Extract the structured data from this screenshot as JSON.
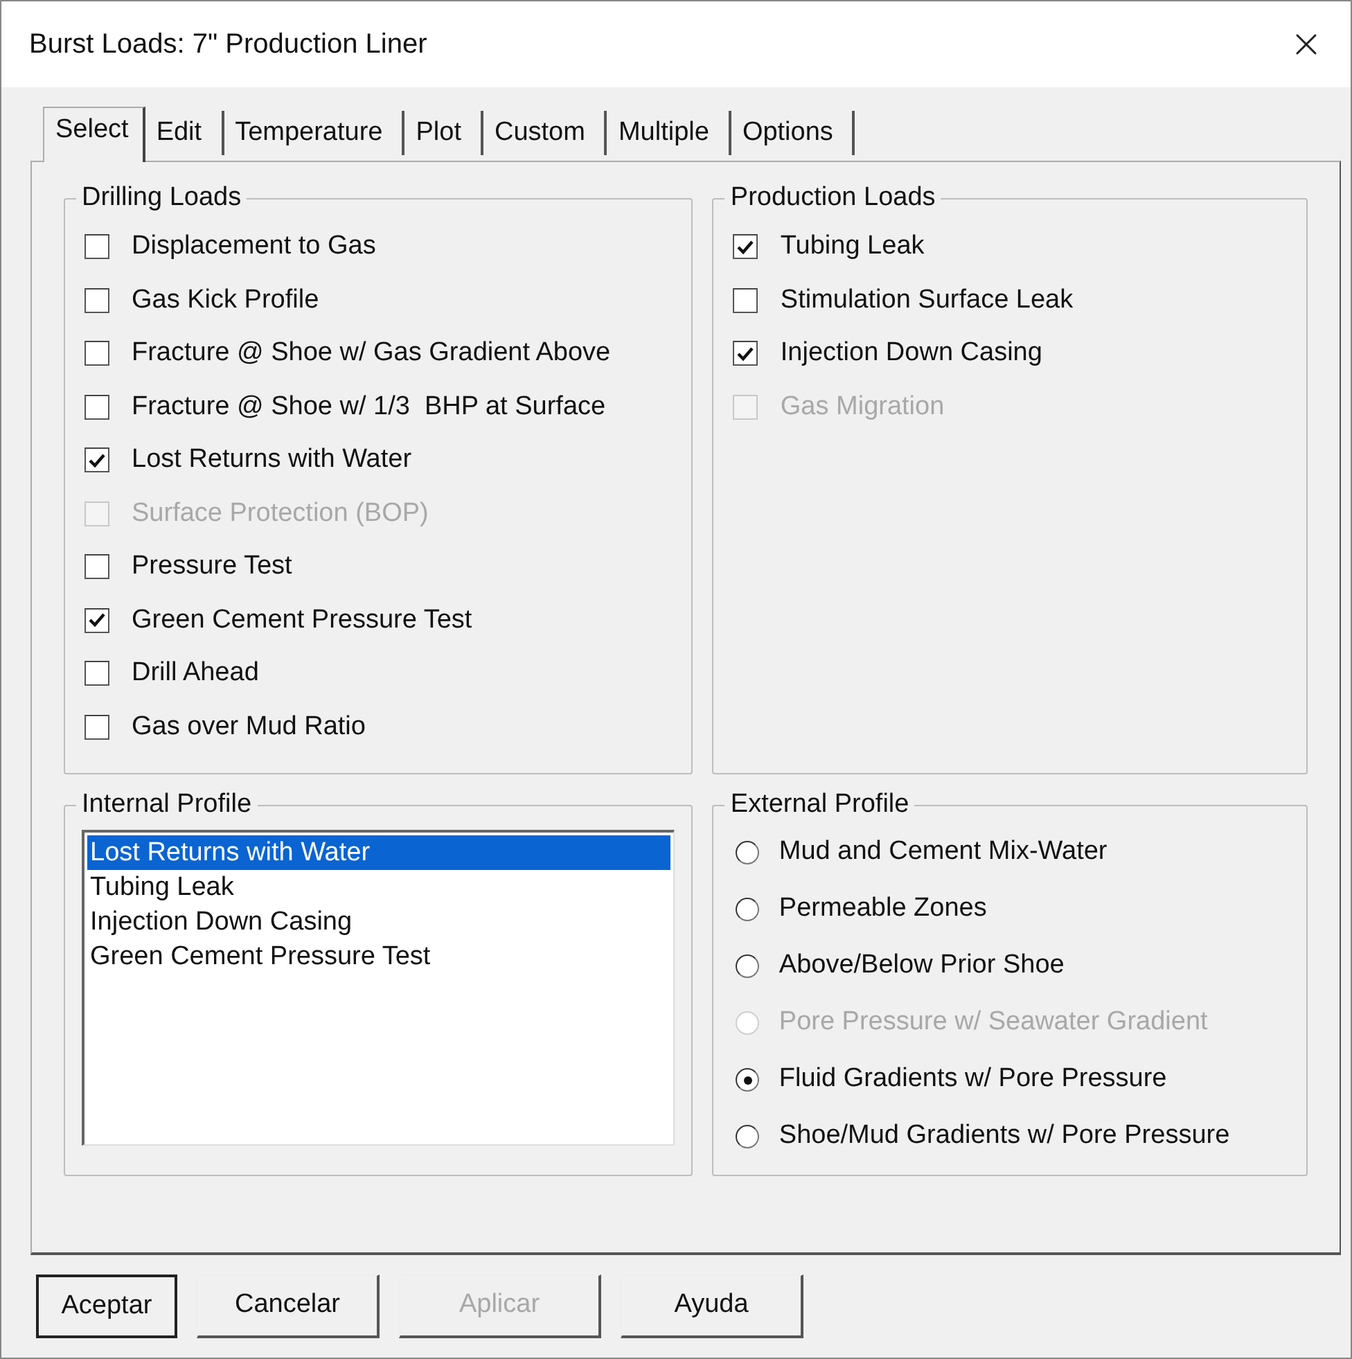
{
  "window": {
    "title": "Burst Loads: 7\" Production Liner"
  },
  "tabs": [
    {
      "label": "Select",
      "selected": true
    },
    {
      "label": "Edit",
      "selected": false
    },
    {
      "label": "Temperature",
      "selected": false
    },
    {
      "label": "Plot",
      "selected": false
    },
    {
      "label": "Custom",
      "selected": false
    },
    {
      "label": "Multiple",
      "selected": false
    },
    {
      "label": "Options",
      "selected": false
    }
  ],
  "drilling_loads": {
    "title": "Drilling Loads",
    "items": [
      {
        "label": "Displacement to Gas",
        "checked": false,
        "disabled": false
      },
      {
        "label": "Gas Kick Profile",
        "checked": false,
        "disabled": false
      },
      {
        "label": "Fracture @ Shoe w/ Gas Gradient Above",
        "checked": false,
        "disabled": false
      },
      {
        "label": "Fracture @ Shoe w/ 1/3  BHP at Surface",
        "checked": false,
        "disabled": false
      },
      {
        "label": "Lost Returns with Water",
        "checked": true,
        "disabled": false
      },
      {
        "label": "Surface Protection (BOP)",
        "checked": false,
        "disabled": true
      },
      {
        "label": "Pressure Test",
        "checked": false,
        "disabled": false
      },
      {
        "label": "Green Cement Pressure Test",
        "checked": true,
        "disabled": false
      },
      {
        "label": "Drill Ahead",
        "checked": false,
        "disabled": false
      },
      {
        "label": "Gas over Mud Ratio",
        "checked": false,
        "disabled": false
      }
    ]
  },
  "production_loads": {
    "title": "Production Loads",
    "items": [
      {
        "label": "Tubing Leak",
        "checked": true,
        "disabled": false
      },
      {
        "label": "Stimulation Surface Leak",
        "checked": false,
        "disabled": false
      },
      {
        "label": "Injection Down Casing",
        "checked": true,
        "disabled": false
      },
      {
        "label": "Gas Migration",
        "checked": false,
        "disabled": true
      }
    ]
  },
  "internal_profile": {
    "title": "Internal Profile",
    "items": [
      {
        "label": "Lost Returns with Water",
        "selected": true
      },
      {
        "label": "Tubing Leak",
        "selected": false
      },
      {
        "label": "Injection Down Casing",
        "selected": false
      },
      {
        "label": "Green Cement Pressure Test",
        "selected": false
      }
    ]
  },
  "external_profile": {
    "title": "External Profile",
    "options": [
      {
        "label": "Mud and Cement Mix-Water",
        "selected": false,
        "disabled": false
      },
      {
        "label": "Permeable Zones",
        "selected": false,
        "disabled": false
      },
      {
        "label": "Above/Below Prior Shoe",
        "selected": false,
        "disabled": false
      },
      {
        "label": "Pore Pressure w/ Seawater Gradient",
        "selected": false,
        "disabled": true
      },
      {
        "label": "Fluid Gradients w/ Pore Pressure",
        "selected": true,
        "disabled": false
      },
      {
        "label": "Shoe/Mud Gradients w/ Pore Pressure",
        "selected": false,
        "disabled": false
      }
    ]
  },
  "buttons": [
    {
      "label": "Aceptar",
      "default": true,
      "disabled": false
    },
    {
      "label": "Cancelar",
      "default": false,
      "disabled": false
    },
    {
      "label": "Aplicar",
      "default": false,
      "disabled": true
    },
    {
      "label": "Ayuda",
      "default": false,
      "disabled": false
    }
  ]
}
